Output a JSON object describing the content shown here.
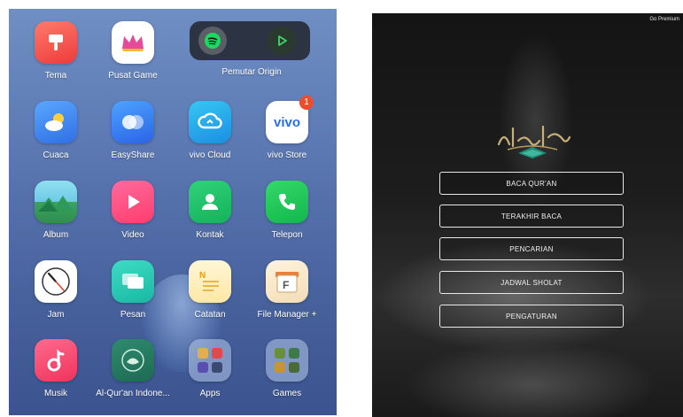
{
  "home_screen": {
    "widget": {
      "label": "Pemutar Origin"
    },
    "apps": [
      {
        "label": "Tema"
      },
      {
        "label": "Pusat Game"
      },
      {
        "label": "Cuaca"
      },
      {
        "label": "EasyShare"
      },
      {
        "label": "vivo Cloud"
      },
      {
        "label": "vivo Store",
        "badge": "1",
        "icon_text": "vivo"
      },
      {
        "label": "Album"
      },
      {
        "label": "Video"
      },
      {
        "label": "Kontak"
      },
      {
        "label": "Telepon"
      },
      {
        "label": "Jam"
      },
      {
        "label": "Pesan"
      },
      {
        "label": "Catatan"
      },
      {
        "label": "File Manager +"
      },
      {
        "label": "Musik"
      },
      {
        "label": "Al-Qur'an Indone..."
      },
      {
        "label": "Apps"
      },
      {
        "label": "Games"
      }
    ]
  },
  "quran_app": {
    "premium_label": "Go Premium",
    "menu": [
      {
        "label": "BACA QUR'AN"
      },
      {
        "label": "TERAKHIR BACA"
      },
      {
        "label": "PENCARIAN"
      },
      {
        "label": "JADWAL SHOLAT"
      },
      {
        "label": "PENGATURAN"
      }
    ]
  }
}
